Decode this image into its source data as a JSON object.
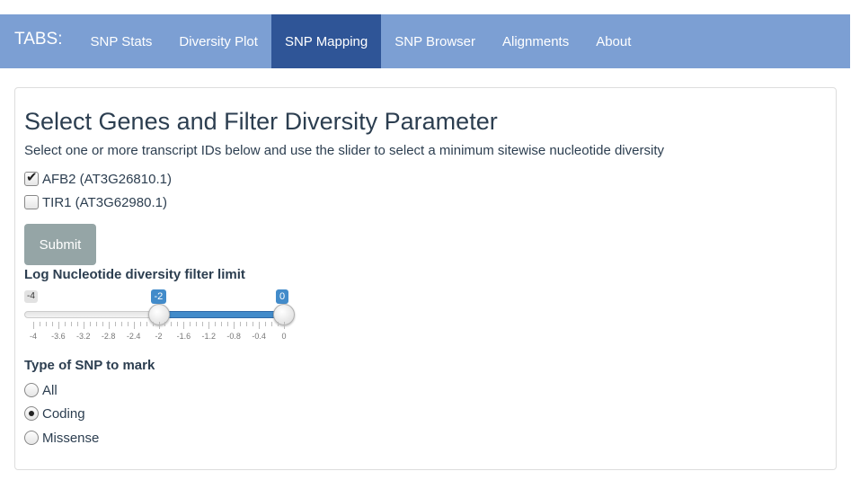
{
  "nav": {
    "brand": "TABS:",
    "tabs": [
      {
        "label": "SNP Stats",
        "active": false
      },
      {
        "label": "Diversity Plot",
        "active": false
      },
      {
        "label": "SNP Mapping",
        "active": true
      },
      {
        "label": "SNP Browser",
        "active": false
      },
      {
        "label": "Alignments",
        "active": false
      },
      {
        "label": "About",
        "active": false
      }
    ],
    "colors": {
      "bar": "#7c9fd3",
      "active": "#2f5597"
    }
  },
  "panel": {
    "title": "Select Genes and Filter Diversity Parameter",
    "subtitle": "Select one or more transcript IDs below and use the slider to select a minimum sitewise nucleotide diversity",
    "genes": [
      {
        "label": "AFB2 (AT3G26810.1)",
        "checked": true
      },
      {
        "label": "TIR1 (AT3G62980.1)",
        "checked": false
      }
    ],
    "submit_label": "Submit",
    "slider": {
      "label": "Log Nucleotide diversity filter limit",
      "min_label": "-4",
      "low_label": "-2",
      "high_label": "0",
      "min": -4,
      "max": 0,
      "low": -2,
      "high": 0,
      "ticks": [
        "-4",
        "-3.6",
        "-3.2",
        "-2.8",
        "-2.4",
        "-2",
        "-1.6",
        "-1.2",
        "-0.8",
        "-0.4",
        "0"
      ]
    },
    "snp_type": {
      "label": "Type of SNP to mark",
      "options": [
        {
          "label": "All",
          "selected": false
        },
        {
          "label": "Coding",
          "selected": true
        },
        {
          "label": "Missense",
          "selected": false
        }
      ]
    }
  }
}
